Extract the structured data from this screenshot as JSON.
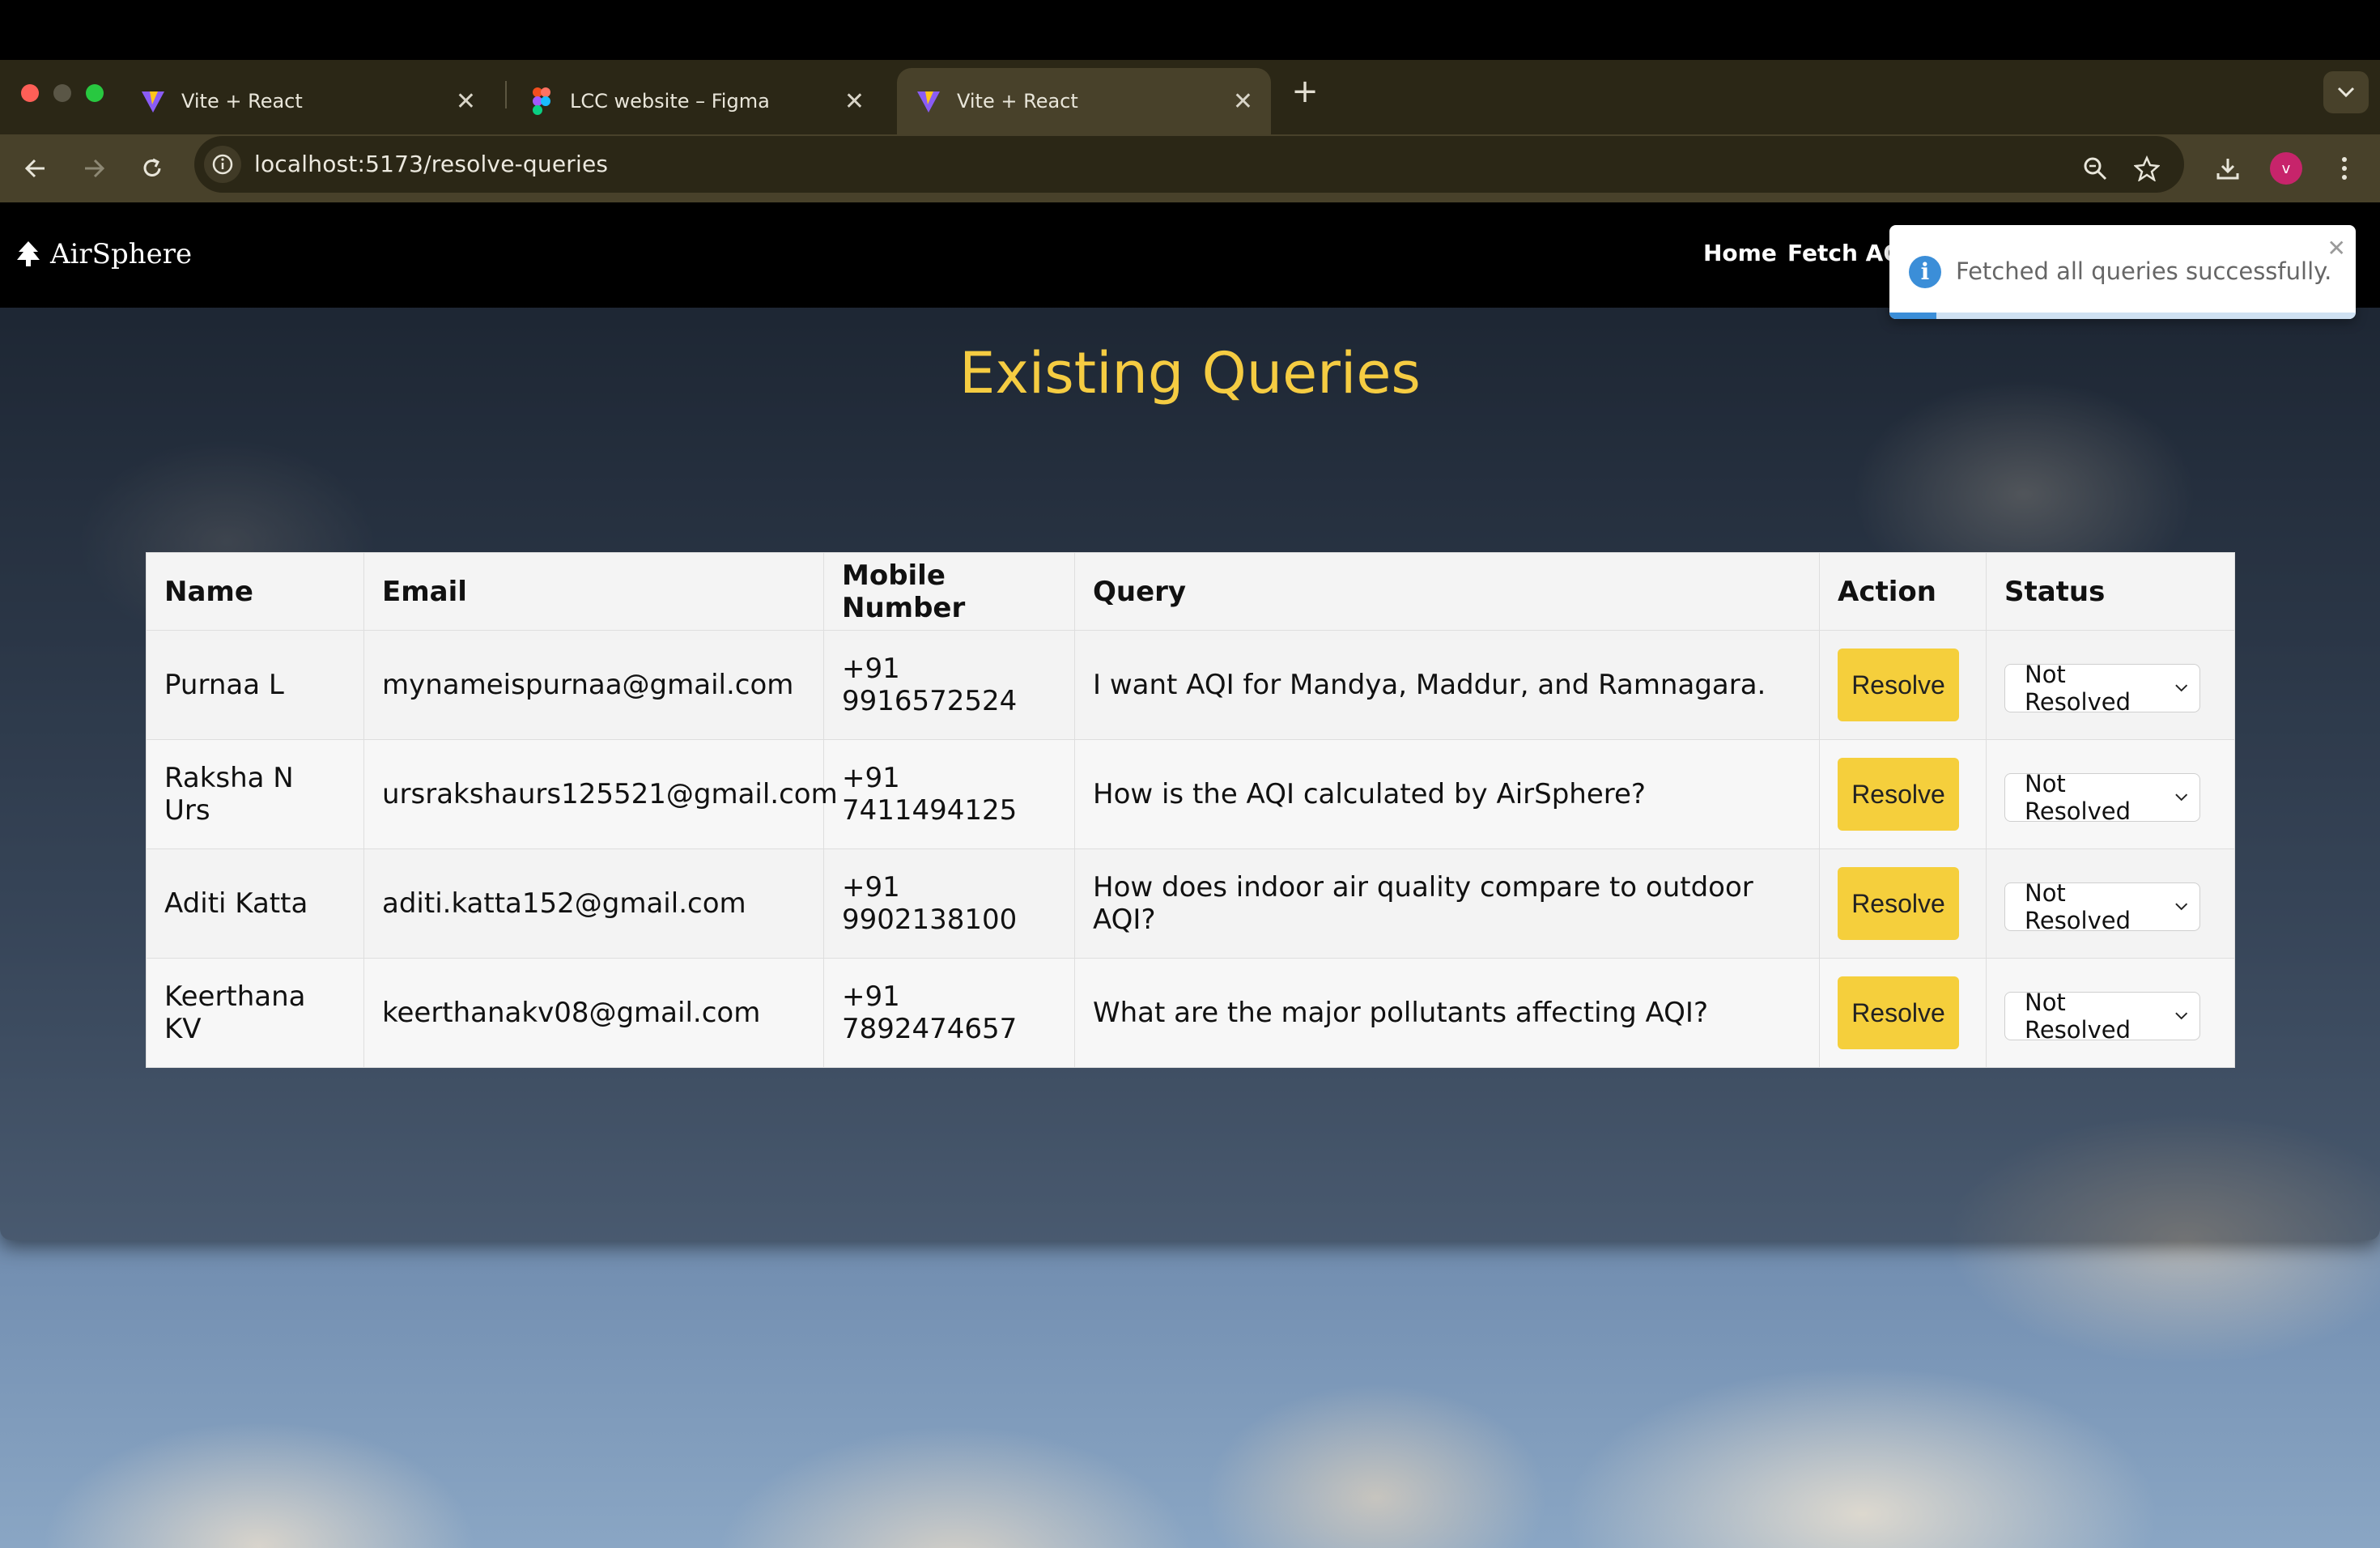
{
  "browser": {
    "tabs": [
      {
        "title": "Vite + React",
        "icon": "vite-icon",
        "active": false
      },
      {
        "title": "LCC website – Figma",
        "icon": "figma-icon",
        "active": false
      },
      {
        "title": "Vite + React",
        "icon": "vite-icon",
        "active": true
      }
    ],
    "url": "localhost:5173/resolve-queries",
    "profile_initial": "V"
  },
  "site": {
    "brand": "AirSphere",
    "nav": {
      "home": "Home",
      "fetch_aqi": "Fetch AQI"
    }
  },
  "main": {
    "heading": "Existing Queries",
    "columns": [
      "Name",
      "Email",
      "Mobile Number",
      "Query",
      "Action",
      "Status"
    ],
    "rows": [
      {
        "name": "Purnaa L",
        "email": "mynameispurnaa@gmail.com",
        "mobile": "+91 9916572524",
        "query": "I want AQI for Mandya, Maddur, and Ramnagara.",
        "action": "Resolve",
        "status": "Not Resolved"
      },
      {
        "name": "Raksha N Urs",
        "email": "ursrakshaurs125521@gmail.com",
        "mobile": "+91 7411494125",
        "query": "How is the AQI calculated by AirSphere?",
        "action": "Resolve",
        "status": "Not Resolved"
      },
      {
        "name": "Aditi Katta",
        "email": "aditi.katta152@gmail.com",
        "mobile": "+91 9902138100",
        "query": "How does indoor air quality compare to outdoor AQI?",
        "action": "Resolve",
        "status": "Not Resolved"
      },
      {
        "name": "Keerthana KV",
        "email": "keerthanakv08@gmail.com",
        "mobile": "+91 7892474657",
        "query": "What are the major pollutants affecting AQI?",
        "action": "Resolve",
        "status": "Not Resolved"
      }
    ]
  },
  "toast": {
    "message": "Fetched all queries successfully.",
    "icon": "info-icon",
    "progress": 0.1
  },
  "colors": {
    "heading": "#f5cc42",
    "resolve_button": "#f5cf3c",
    "toast_accent": "#3b8ed8"
  }
}
